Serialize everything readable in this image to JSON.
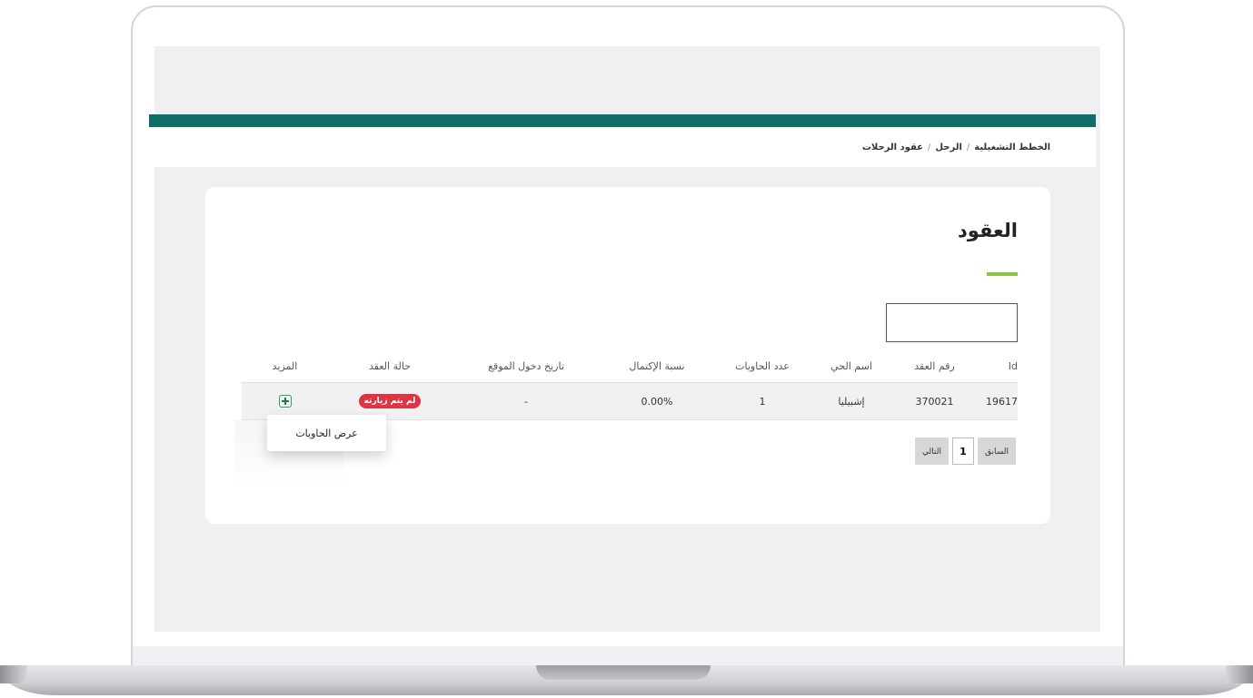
{
  "breadcrumb": [
    "الخطط التشغيلية",
    "الرحل",
    "عقود الرحلات"
  ],
  "breadcrumb_sep": "/",
  "page": {
    "title": "العقود"
  },
  "search": {
    "value": "",
    "placeholder": ""
  },
  "table": {
    "headers": {
      "id": "Id",
      "contract_number": "رقم العقد",
      "district": "اسم الحي",
      "containers": "عدد الحاويات",
      "completion": "نسبة الإكتمال",
      "entry_date": "تاريخ دخول الموقع",
      "status": "حالة العقد",
      "more": "المزيد"
    },
    "rows": [
      {
        "id": "19617",
        "contract_number": "370021",
        "district": "إشبيليا",
        "containers": "1",
        "completion": "0.00%",
        "entry_date": "-",
        "status": "لم يتم زيارته",
        "more_icon": "table-grid-icon"
      }
    ]
  },
  "dropdown": {
    "item": "عرض الحاويات"
  },
  "pagination": {
    "prev": "السابق",
    "current": "1",
    "next": "التالي"
  },
  "colors": {
    "header_bar": "#0f6f67",
    "accent": "#8bc34a",
    "status_badge": "#dc3545"
  }
}
